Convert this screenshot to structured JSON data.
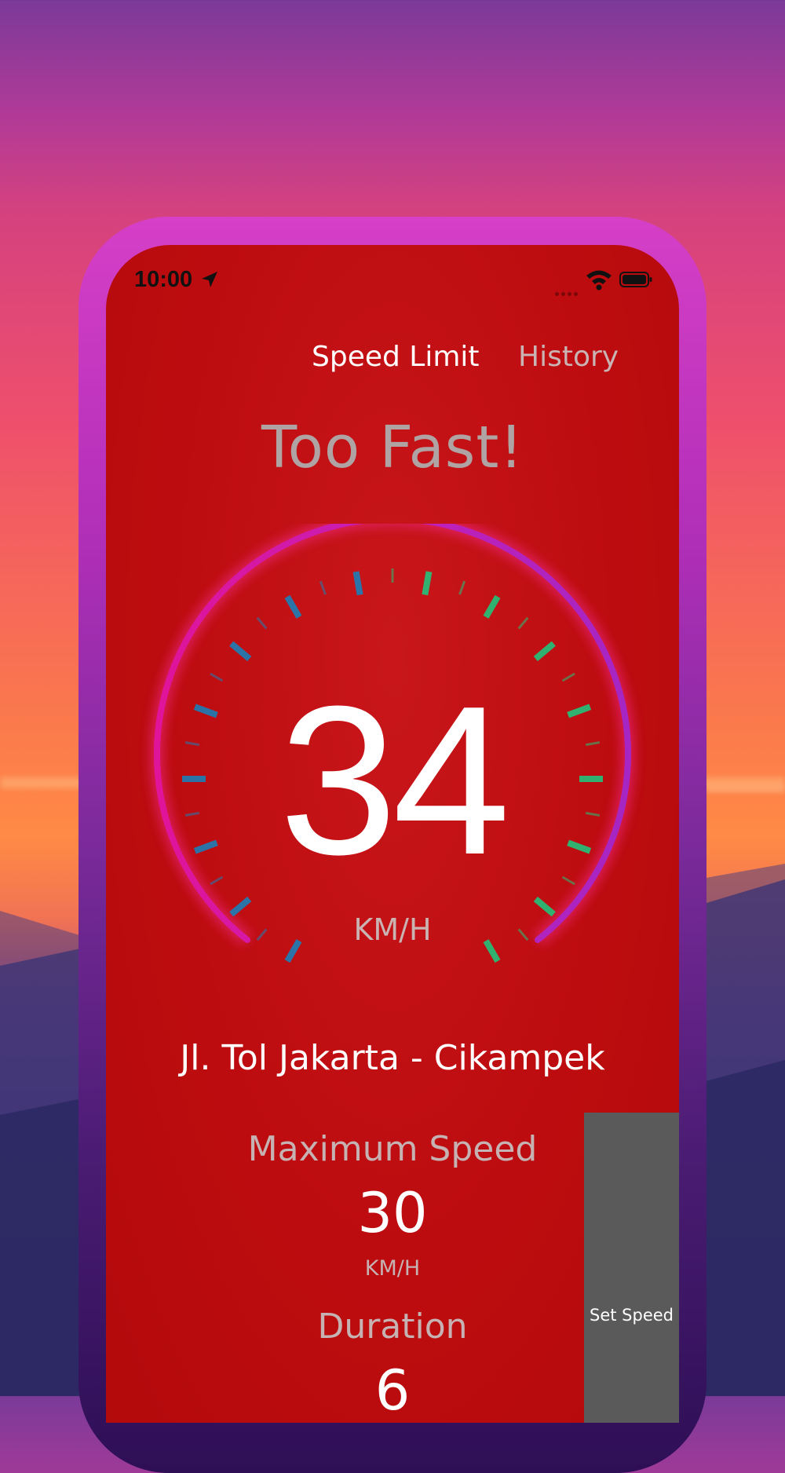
{
  "status_bar": {
    "time": "10:00"
  },
  "tabs": [
    {
      "label": "Speed Limit",
      "active": true
    },
    {
      "label": "History",
      "active": false
    }
  ],
  "alert": {
    "title": "Too Fast!"
  },
  "speedometer": {
    "value": "34",
    "unit": "KM/H"
  },
  "road_name": "Jl. Tol Jakarta - Cikampek",
  "limit": {
    "max_label": "Maximum Speed",
    "max_value": "30",
    "max_unit": "KM/H",
    "duration_label": "Duration",
    "duration_value": "6"
  },
  "set_speed_button": {
    "label": "Set Speed"
  },
  "colors": {
    "screen_background": "#bd0c0f",
    "gauge_ring_start": "#e0149a",
    "gauge_ring_end": "#a526c4",
    "tick_cool": "#1c7fb8",
    "tick_warm": "#22c37a",
    "set_speed_button": "#5a5a5a"
  }
}
